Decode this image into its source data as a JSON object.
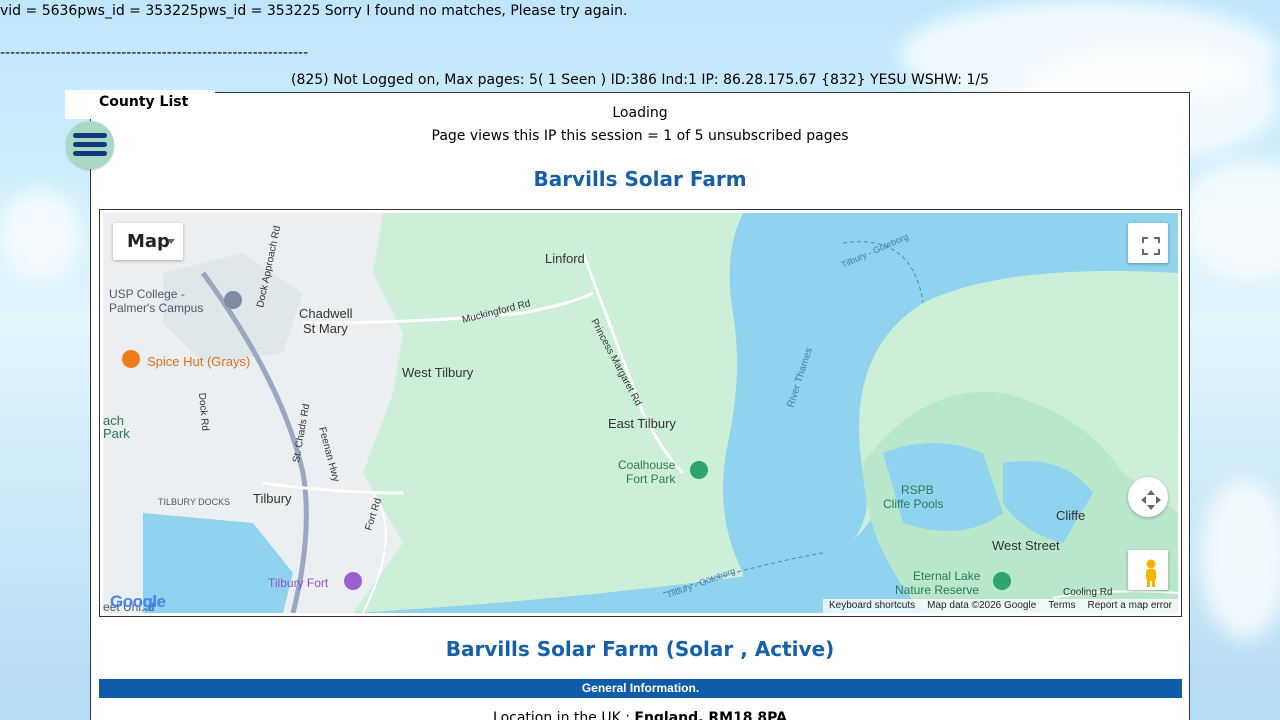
{
  "debug_text": "vid = 5636pws_id = 353225pws_id = 353225 Sorry I found no matches, Please try again.",
  "dash_line": "-------------------------------------------------------------",
  "status_line": "(825) Not Logged on, Max pages: 5( 1 Seen ) ID:386 Ind:1 IP: 86.28.175.67 {832} YESU WSHW: 1/5",
  "sidebar": {
    "county_list": "County List",
    "menu_icon": "hamburger-menu-icon"
  },
  "panel": {
    "loading": "Loading",
    "page_views": "Page views this IP this session = 1 of 5 unsubscribed pages",
    "title": "Barvills Solar Farm"
  },
  "map": {
    "type_label": "Map",
    "labels": {
      "linford": "Linford",
      "usp_college": "USP College -",
      "palmers": "Palmer's Campus",
      "chadwell_1": "Chadwell",
      "chadwell_2": "St Mary",
      "muckingford": "Muckingford Rd",
      "princess_margaret": "Princess Margaret Rd",
      "spice_hut": "Spice Hut (Grays)",
      "west_tilbury": "West Tilbury",
      "dock_approach": "Dock Approach Rd",
      "dock_rd": "Dock Rd",
      "st_chads": "St. Chads Rd",
      "ferry": "Feenan Hwy",
      "east_tilbury": "East Tilbury",
      "coalhouse_1": "Coalhouse",
      "coalhouse_2": "Fort Park",
      "river_thames": "River Thames",
      "tilbury_docks": "TILBURY DOCKS",
      "tilbury": "Tilbury",
      "fort_rd": "Fort Rd",
      "tilbury_fort": "Tilbury Fort",
      "rspb_1": "RSPB",
      "rspb_2": "Cliffe Pools",
      "cliffe": "Cliffe",
      "west_street": "West Street",
      "eternal_1": "Eternal Lake",
      "eternal_2": "Nature Reserve",
      "cooling_rd": "Cooling Rd",
      "tilbury_goteborg_top": "Tilbury - Göteborg",
      "tilbury_goteborg_bottom": "Tilbury - Göteborg",
      "ach": "ach",
      "park": "Park",
      "east_ul": "eet Uni..d"
    },
    "google": "Google",
    "footer": {
      "keyboard": "Keyboard shortcuts",
      "data": "Map data ©2026 Google",
      "terms": "Terms",
      "report": "Report a map error"
    },
    "colors": {
      "water": "#8fd3ee",
      "land_green": "#cdefd8",
      "urban": "#eceff1",
      "road": "#ffffff",
      "major_road": "#9aa7c0"
    }
  },
  "farm_heading": "Barvills Solar Farm (Solar , Active)",
  "general_bar": "General Information.",
  "location": {
    "label": "Location in the UK : ",
    "value": "England, RM18 8PA"
  }
}
